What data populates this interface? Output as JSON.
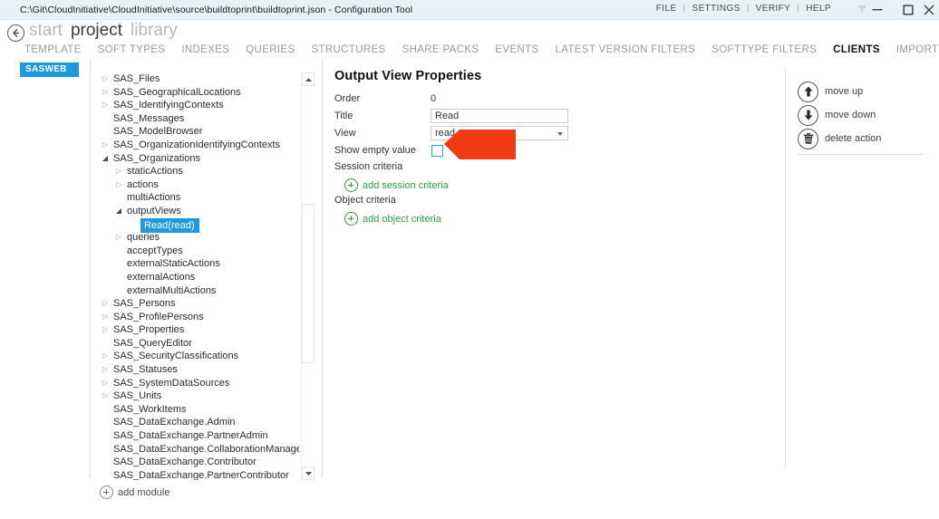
{
  "titlebar": {
    "title": "C:\\Git\\CloudInitiative\\CloudInitiative\\source\\buildtoprint\\buildtoprint.json - Configuration Tool",
    "menu": [
      "FILE",
      "SETTINGS",
      "VERIFY",
      "HELP"
    ],
    "separator": "|",
    "ribbon_icon": "ribbon-options-icon",
    "minimize_icon": "minimize-icon",
    "maximize_icon": "maximize-icon",
    "close_icon": "close-icon"
  },
  "header": {
    "back_icon": "back-arrow-icon",
    "breadcrumbs": [
      {
        "label": "start",
        "active": false
      },
      {
        "label": "project",
        "active": true
      },
      {
        "label": "library",
        "active": false
      }
    ]
  },
  "tabs": [
    {
      "label": "TEMPLATE",
      "active": false
    },
    {
      "label": "SOFT TYPES",
      "active": false
    },
    {
      "label": "INDEXES",
      "active": false
    },
    {
      "label": "QUERIES",
      "active": false
    },
    {
      "label": "STRUCTURES",
      "active": false
    },
    {
      "label": "SHARE PACKS",
      "active": false
    },
    {
      "label": "EVENTS",
      "active": false
    },
    {
      "label": "LATEST VERSION FILTERS",
      "active": false
    },
    {
      "label": "SOFTTYPE FILTERS",
      "active": false
    },
    {
      "label": "CLIENTS",
      "active": true
    },
    {
      "label": "IMPORT ATTRIBUTES",
      "active": false
    }
  ],
  "module_tag": {
    "label": "SASWEB",
    "color": "#1e9bdc"
  },
  "tree": {
    "nodes": [
      {
        "label": "SAS_Files",
        "depth": 0,
        "twisty": "collapsed",
        "selected": false
      },
      {
        "label": "SAS_GeographicalLocations",
        "depth": 0,
        "twisty": "collapsed",
        "selected": false
      },
      {
        "label": "SAS_IdentifyingContexts",
        "depth": 0,
        "twisty": "collapsed",
        "selected": false
      },
      {
        "label": "SAS_Messages",
        "depth": 0,
        "twisty": "none",
        "selected": false
      },
      {
        "label": "SAS_ModelBrowser",
        "depth": 0,
        "twisty": "none",
        "selected": false
      },
      {
        "label": "SAS_OrganizationIdentifyingContexts",
        "depth": 0,
        "twisty": "collapsed",
        "selected": false
      },
      {
        "label": "SAS_Organizations",
        "depth": 0,
        "twisty": "expanded",
        "selected": false
      },
      {
        "label": "staticActions",
        "depth": 1,
        "twisty": "collapsed",
        "selected": false
      },
      {
        "label": "actions",
        "depth": 1,
        "twisty": "collapsed",
        "selected": false
      },
      {
        "label": "multiActions",
        "depth": 1,
        "twisty": "none",
        "selected": false
      },
      {
        "label": "outputViews",
        "depth": 1,
        "twisty": "expanded",
        "selected": false
      },
      {
        "label": "Read(read)",
        "depth": 2,
        "twisty": "none",
        "selected": true
      },
      {
        "label": "queries",
        "depth": 1,
        "twisty": "collapsed",
        "selected": false
      },
      {
        "label": "acceptTypes",
        "depth": 1,
        "twisty": "none",
        "selected": false
      },
      {
        "label": "externalStaticActions",
        "depth": 1,
        "twisty": "none",
        "selected": false
      },
      {
        "label": "externalActions",
        "depth": 1,
        "twisty": "none",
        "selected": false
      },
      {
        "label": "externalMultiActions",
        "depth": 1,
        "twisty": "none",
        "selected": false
      },
      {
        "label": "SAS_Persons",
        "depth": 0,
        "twisty": "collapsed",
        "selected": false
      },
      {
        "label": "SAS_ProfilePersons",
        "depth": 0,
        "twisty": "collapsed",
        "selected": false
      },
      {
        "label": "SAS_Properties",
        "depth": 0,
        "twisty": "collapsed",
        "selected": false
      },
      {
        "label": "SAS_QueryEditor",
        "depth": 0,
        "twisty": "none",
        "selected": false
      },
      {
        "label": "SAS_SecurityClassifications",
        "depth": 0,
        "twisty": "collapsed",
        "selected": false
      },
      {
        "label": "SAS_Statuses",
        "depth": 0,
        "twisty": "collapsed",
        "selected": false
      },
      {
        "label": "SAS_SystemDataSources",
        "depth": 0,
        "twisty": "collapsed",
        "selected": false
      },
      {
        "label": "SAS_Units",
        "depth": 0,
        "twisty": "collapsed",
        "selected": false
      },
      {
        "label": "SAS_WorkItems",
        "depth": 0,
        "twisty": "none",
        "selected": false
      },
      {
        "label": "SAS_DataExchange.Admin",
        "depth": 0,
        "twisty": "none",
        "selected": false
      },
      {
        "label": "SAS_DataExchange.PartnerAdmin",
        "depth": 0,
        "twisty": "none",
        "selected": false
      },
      {
        "label": "SAS_DataExchange.CollaborationManager",
        "depth": 0,
        "twisty": "none",
        "selected": false
      },
      {
        "label": "SAS_DataExchange.Contributor",
        "depth": 0,
        "twisty": "none",
        "selected": false
      },
      {
        "label": "SAS_DataExchange.PartnerContributor",
        "depth": 0,
        "twisty": "none",
        "selected": false
      }
    ],
    "add_module_label": "add module"
  },
  "properties": {
    "heading": "Output View Properties",
    "order_label": "Order",
    "order_value": "0",
    "title_label": "Title",
    "title_value": "Read",
    "view_label": "View",
    "view_value": "read",
    "show_empty_label": "Show empty value",
    "show_empty_checked": false,
    "session_criteria_label": "Session criteria",
    "add_session_criteria_label": "add session criteria",
    "object_criteria_label": "Object criteria",
    "add_object_criteria_label": "add object criteria",
    "link_color": "#2f9e44"
  },
  "annotation": {
    "shape": "left-pointing-arrow",
    "color": "#F23B14"
  },
  "actions": [
    {
      "label": "move up",
      "icon": "arrow-up-icon"
    },
    {
      "label": "move down",
      "icon": "arrow-down-icon"
    },
    {
      "label": "delete action",
      "icon": "trash-icon"
    }
  ]
}
